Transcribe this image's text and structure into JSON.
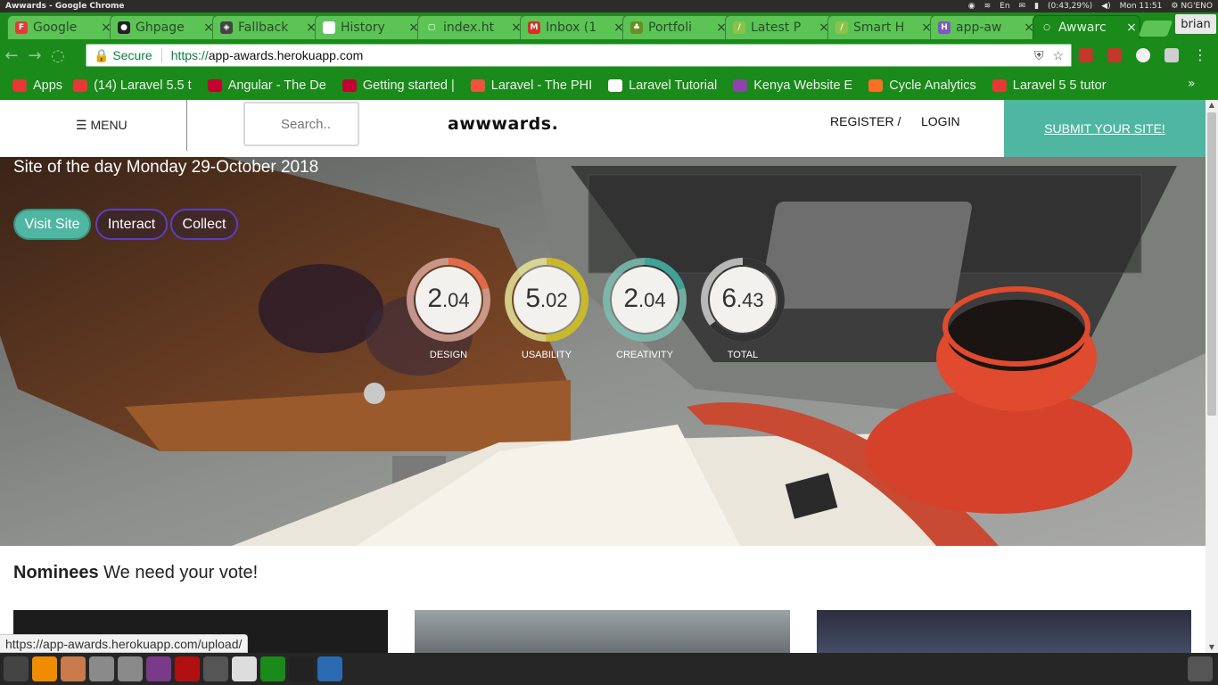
{
  "os": {
    "window_title": "Awwards - Google Chrome",
    "battery": "(0:43,29%)",
    "lang": "En",
    "clock": "Mon 11:51",
    "user": "NG'ENO"
  },
  "tabs": [
    {
      "label": "Google",
      "icon_color": "#e53935",
      "icon_glyph": "F"
    },
    {
      "label": "Ghpage",
      "icon_color": "#222222",
      "icon_glyph": "●"
    },
    {
      "label": "Fallback",
      "icon_color": "#444444",
      "icon_glyph": "◈"
    },
    {
      "label": "History",
      "icon_color": "#ffffff",
      "icon_glyph": "W"
    },
    {
      "label": "index.ht",
      "icon_color": "#5cc455",
      "icon_glyph": "▢"
    },
    {
      "label": "Inbox (1",
      "icon_color": "#d93025",
      "icon_glyph": "M"
    },
    {
      "label": "Portfoli",
      "icon_color": "#6b8e23",
      "icon_glyph": "♣"
    },
    {
      "label": "Latest P",
      "icon_color": "#8bc34a",
      "icon_glyph": "/"
    },
    {
      "label": "Smart H",
      "icon_color": "#8bc34a",
      "icon_glyph": "/"
    },
    {
      "label": "app-aw",
      "icon_color": "#7e57c2",
      "icon_glyph": "H"
    },
    {
      "label": "Awwarc",
      "icon_color": "#1a8a1a",
      "icon_glyph": "○",
      "active": true
    }
  ],
  "profile": "brian",
  "address": {
    "secure_label": "Secure",
    "scheme": "https://",
    "host": "app-awards.herokuapp.com"
  },
  "bookmarks": [
    {
      "label": "Apps",
      "icon_color": "#e53935"
    },
    {
      "label": "(14) Laravel 5.5 t",
      "icon_color": "#e53935"
    },
    {
      "label": "Angular - The De",
      "icon_color": "#c3002f"
    },
    {
      "label": "Getting started |",
      "icon_color": "#c3002f"
    },
    {
      "label": "Laravel - The PHI",
      "icon_color": "#f05340"
    },
    {
      "label": "Laravel Tutorial",
      "icon_color": "#ffffff"
    },
    {
      "label": "Kenya Website E",
      "icon_color": "#8e44ad"
    },
    {
      "label": "Cycle Analytics",
      "icon_color": "#fc6d26"
    },
    {
      "label": "Laravel 5 5 tutor",
      "icon_color": "#e53935"
    }
  ],
  "site": {
    "menu_label": "☰ MENU",
    "search_placeholder": "Search..",
    "logo": "awwwards.",
    "register_label": "REGISTER /",
    "login_label": "LOGIN",
    "submit_label": "SUBMIT YOUR SITE!",
    "site_of_day": "Site of the day Monday 29-October 2018",
    "buttons": {
      "visit": "Visit Site",
      "interact": "Interact",
      "collect": "Collect"
    },
    "scores": [
      {
        "label": "DESIGN",
        "int": "2",
        "dec": ".04",
        "value": 2.04,
        "color": "#e06a4a",
        "track": "#d9a79a"
      },
      {
        "label": "USABILITY",
        "int": "5",
        "dec": ".02",
        "value": 5.02,
        "color": "#c9b829",
        "track": "#e6e49a"
      },
      {
        "label": "CREATIVITY",
        "int": "2",
        "dec": ".04",
        "value": 2.04,
        "color": "#3fa397",
        "track": "#7dbfb2"
      },
      {
        "label": "TOTAL",
        "int": "6",
        "dec": ".43",
        "value": 6.43,
        "color": "#333333",
        "track": "#cfcfcf"
      }
    ],
    "score_max": 10,
    "nominees_title": "Nominees",
    "nominees_sub": " We need your vote!"
  },
  "status_url": "https://app-awards.herokuapp.com/upload/"
}
